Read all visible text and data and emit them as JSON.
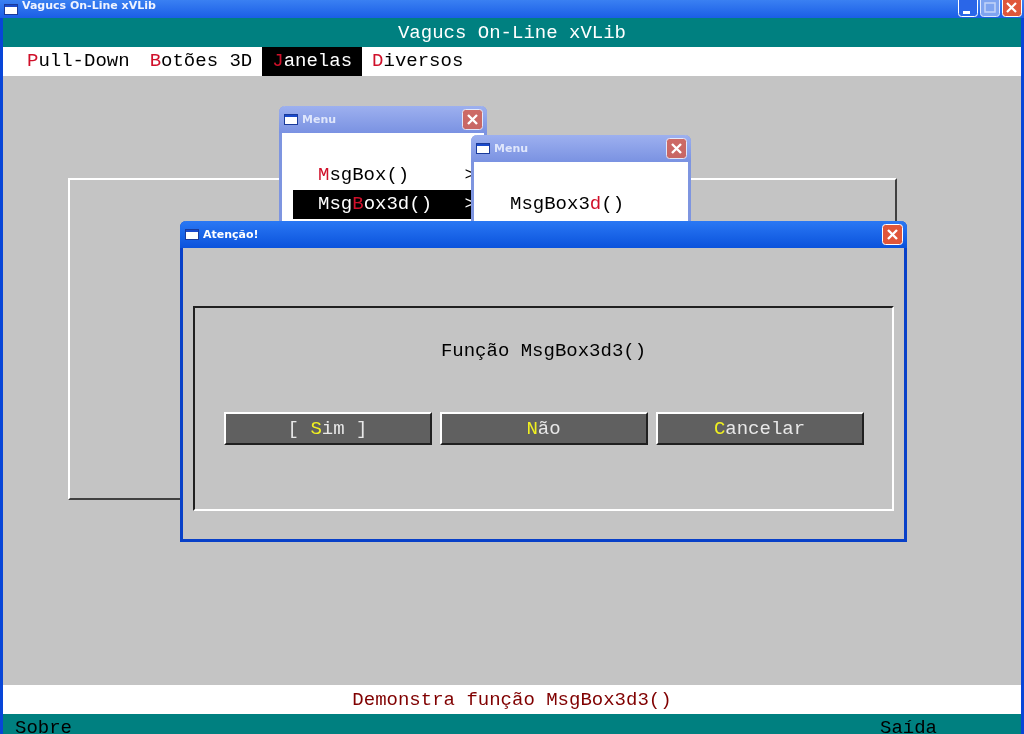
{
  "window": {
    "title": "Vagucs On-Line xVLib"
  },
  "app_title": "Vagucs On-Line xVLib",
  "menu_bar": [
    {
      "key": "P",
      "post": "ull-Down",
      "selected": false
    },
    {
      "key": "B",
      "post": "otões 3D",
      "selected": false
    },
    {
      "key": "J",
      "post": "anelas",
      "selected": true
    },
    {
      "key": "D",
      "post": "iversos",
      "selected": false
    }
  ],
  "menus": [
    {
      "title": "Menu",
      "items": [
        {
          "key": "M",
          "post": "sgBox()",
          "arrow": ">",
          "selected": false
        },
        {
          "pre": "Msg",
          "key": "B",
          "post": "ox3d()",
          "arrow": ">",
          "selected": true
        }
      ]
    },
    {
      "title": "Menu",
      "items": [
        {
          "pre": "MsgBox3",
          "key": "d",
          "post": "()",
          "selected": false
        }
      ]
    }
  ],
  "dialog": {
    "title": "Atenção!",
    "message": "Função MsgBox3d3()",
    "buttons": [
      {
        "pre": "[ ",
        "key": "S",
        "post": "im ]"
      },
      {
        "key": "N",
        "post": "ão"
      },
      {
        "key": "C",
        "post": "ancelar"
      }
    ]
  },
  "message_line": "Demonstra função MsgBox3d3()",
  "bottom_bar": {
    "left": "Sobre",
    "right": "Saída"
  }
}
